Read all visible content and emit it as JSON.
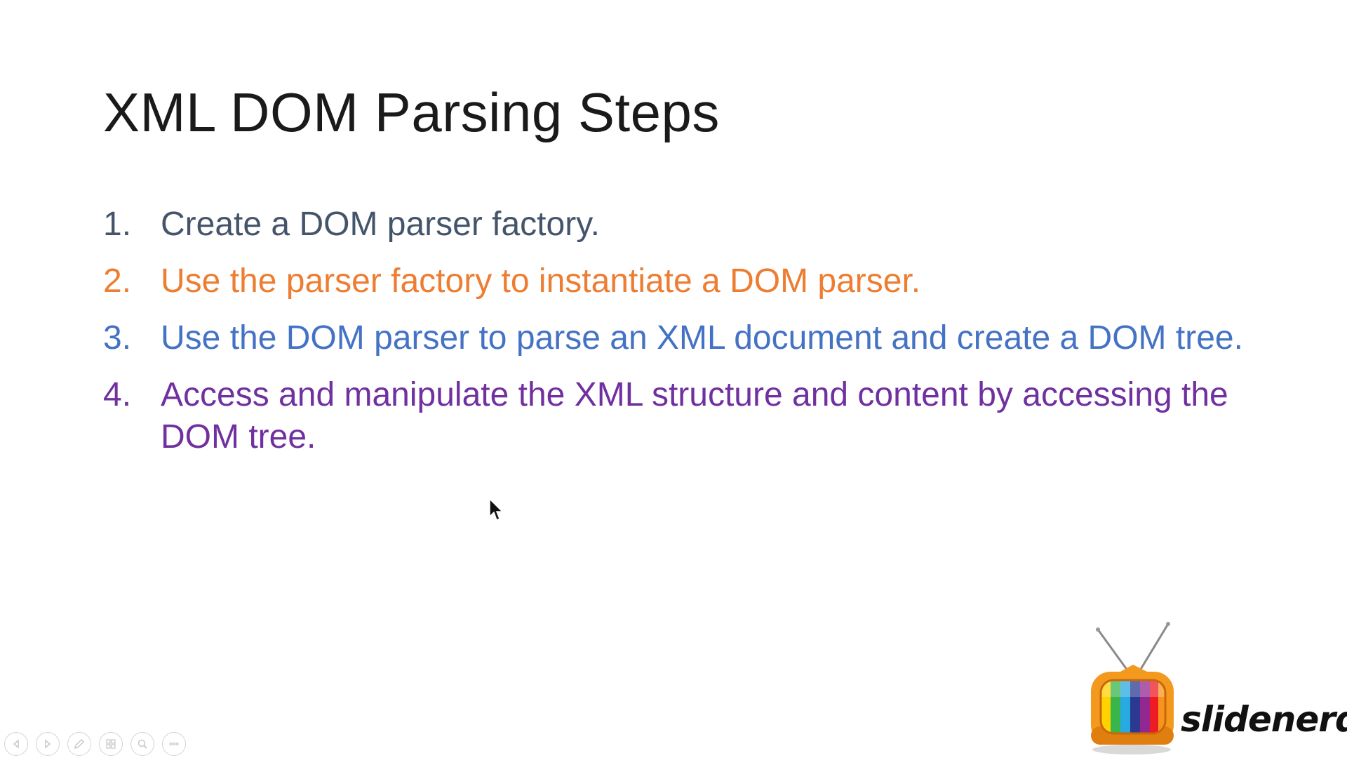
{
  "slide": {
    "title": "XML DOM Parsing Steps",
    "steps": [
      {
        "number": "1.",
        "text": "Create a DOM parser factory.",
        "color": "#44546A"
      },
      {
        "number": "2.",
        "text": "Use the parser factory to instantiate a DOM parser.",
        "color": "#ED7D31"
      },
      {
        "number": "3.",
        "text": "Use the DOM parser to parse an XML document and create a DOM tree.",
        "color": "#4472C4"
      },
      {
        "number": "4.",
        "text": "Access and manipulate the XML structure and content by accessing the DOM tree.",
        "color": "#7030A0"
      }
    ]
  },
  "logo": {
    "text": "slidenerd",
    "icon": "tv-icon"
  },
  "toolbar": {
    "buttons": [
      "previous-slide-icon",
      "next-slide-icon",
      "pen-icon",
      "slides-grid-icon",
      "zoom-icon",
      "more-options-icon"
    ]
  }
}
